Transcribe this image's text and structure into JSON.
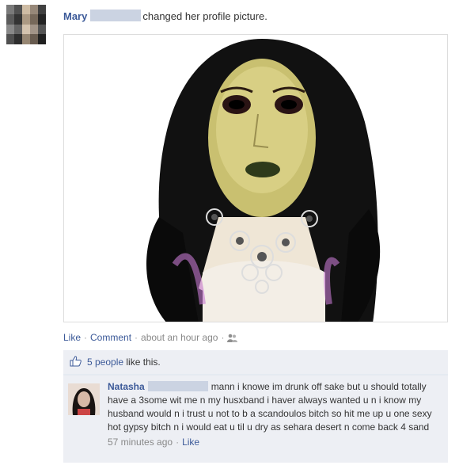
{
  "post": {
    "author": "Mary",
    "action": "changed her profile picture."
  },
  "meta": {
    "like": "Like",
    "comment": "Comment",
    "time": "about an hour ago"
  },
  "likes": {
    "count_link": "5 people",
    "suffix": "like this."
  },
  "comment": {
    "author": "Natasha",
    "text": "mann i knowe im drunk off sake but u should totally have a 3some wit me n my husxband i haver always wanted u n i know my husband would n i trust u not to b a scandoulos bitch so hit me up u one sexy hot gypsy bitch n i would eat u til u dry as sehara desert n come back 4 sand",
    "time": "57 minutes ago",
    "like": "Like"
  },
  "colors": {
    "link": "#3b5998",
    "ufi_bg": "#edeff4"
  },
  "icons": [
    "pixelated-avatar",
    "friends-icon",
    "thumbs-up-icon"
  ]
}
